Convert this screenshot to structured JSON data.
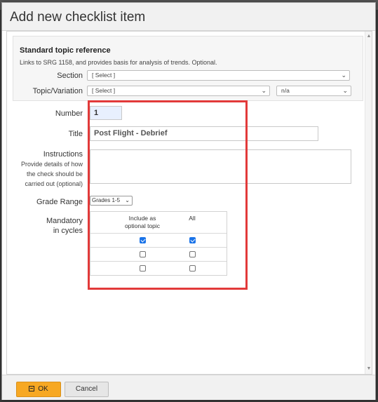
{
  "dialog": {
    "title": "Add new checklist item",
    "standard_topic": {
      "heading": "Standard topic reference",
      "description": "Links to SRG 1158, and provides basis for analysis of trends. Optional.",
      "section_label": "Section",
      "section_value": "[ Select ]",
      "topic_label": "Topic/Variation",
      "topic_value": "[ Select ]",
      "variation_value": "n/a"
    },
    "number": {
      "label": "Number",
      "value": "1"
    },
    "title_field": {
      "label": "Title",
      "value": "Post Flight - Debrief"
    },
    "instructions": {
      "label": "Instructions",
      "help": [
        "Provide details of how",
        "the check should be",
        "carried out (optional)"
      ],
      "value": ""
    },
    "grade_range": {
      "label": "Grade Range",
      "value": "Grades 1-5"
    },
    "mandatory": {
      "label_lines": [
        "Mandatory",
        "in cycles"
      ],
      "col_optional": [
        "Include as",
        "optional topic"
      ],
      "col_all": "All",
      "rows": [
        {
          "optional": true,
          "all": true
        },
        {
          "optional": false,
          "all": false
        },
        {
          "optional": false,
          "all": false
        }
      ]
    },
    "buttons": {
      "ok": "OK",
      "cancel": "Cancel"
    }
  }
}
